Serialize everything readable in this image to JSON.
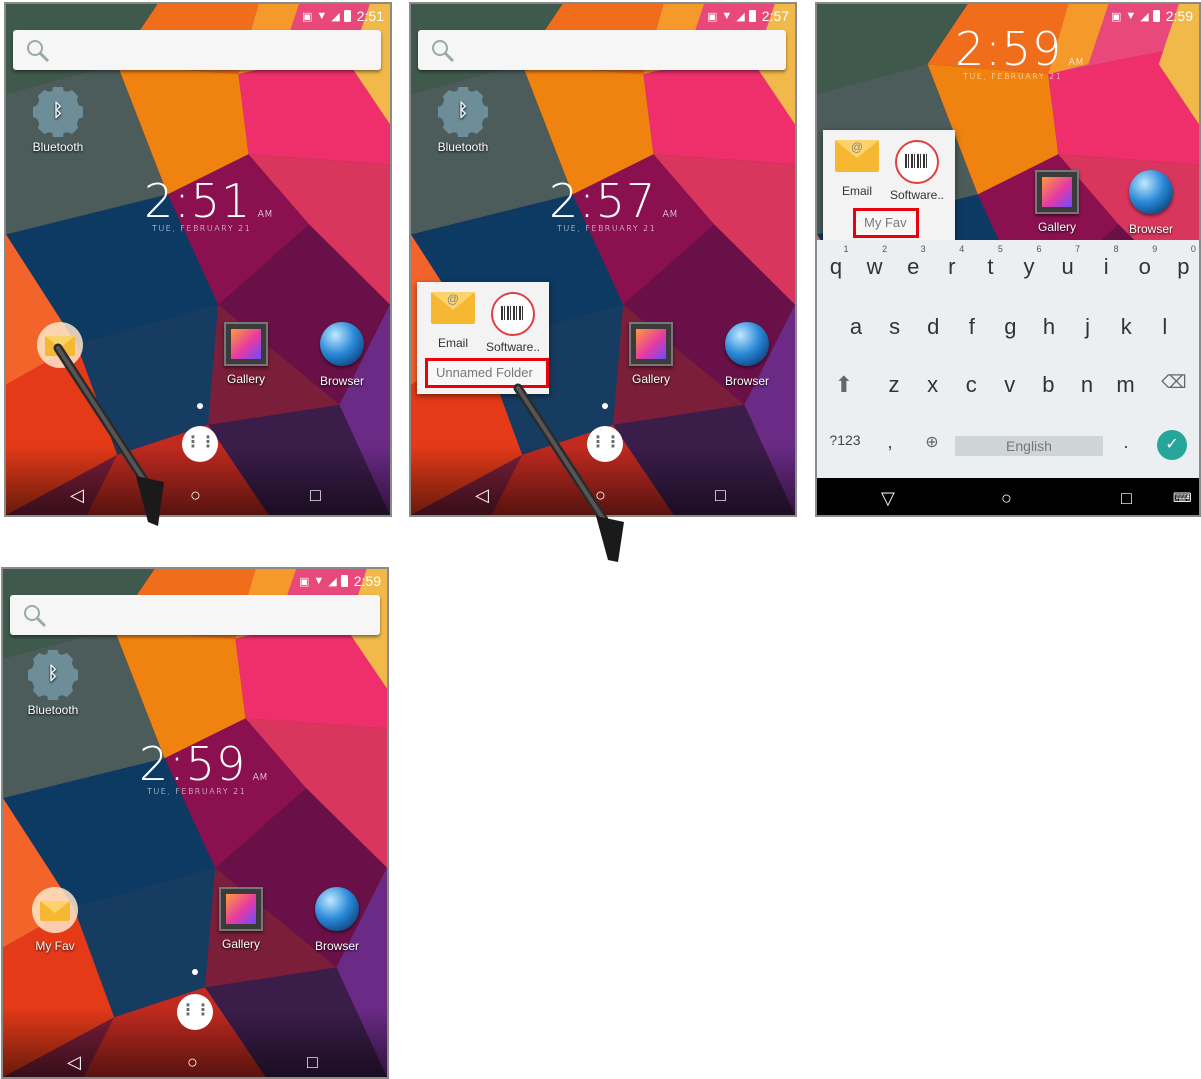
{
  "panel1": {
    "time": "2:51",
    "clock_big": "2:51",
    "clock_ampm": "AM",
    "date": "TUE, FEBRUARY 21",
    "apps": {
      "bluetooth": "Bluetooth",
      "gallery": "Gallery",
      "browser": "Browser"
    }
  },
  "panel2": {
    "time": "2:57",
    "clock_big": "2:57",
    "clock_ampm": "AM",
    "date": "TUE, FEBRUARY 21",
    "apps": {
      "bluetooth": "Bluetooth",
      "gallery": "Gallery",
      "browser": "Browser"
    },
    "folder": {
      "items": [
        "Email",
        "Software.."
      ],
      "name": "Unnamed Folder"
    }
  },
  "panel3": {
    "time": "2:59",
    "clock_big": "2:59",
    "clock_ampm": "AM",
    "date": "TUE, FEBRUARY 21",
    "apps": {
      "gallery": "Gallery",
      "browser": "Browser"
    },
    "folder": {
      "items": [
        "Email",
        "Software.."
      ],
      "name": "My Fav"
    },
    "keyboard": {
      "row1": [
        "q",
        "w",
        "e",
        "r",
        "t",
        "y",
        "u",
        "i",
        "o",
        "p"
      ],
      "row1_hints": [
        "1",
        "2",
        "3",
        "4",
        "5",
        "6",
        "7",
        "8",
        "9",
        "0"
      ],
      "row2": [
        "a",
        "s",
        "d",
        "f",
        "g",
        "h",
        "j",
        "k",
        "l"
      ],
      "row3": [
        "z",
        "x",
        "c",
        "v",
        "b",
        "n",
        "m"
      ],
      "symbols_key": "?123",
      "comma_key": ",",
      "period_key": ".",
      "space_label": "English"
    }
  },
  "panel4": {
    "time": "2:59",
    "clock_big": "2:59",
    "clock_ampm": "AM",
    "date": "TUE, FEBRUARY 21",
    "apps": {
      "bluetooth": "Bluetooth",
      "myfav": "My Fav",
      "gallery": "Gallery",
      "browser": "Browser"
    }
  },
  "icons": [
    "search-icon",
    "bluetooth-icon",
    "gallery-icon",
    "browser-icon",
    "email-icon",
    "barcode-icon",
    "app-drawer-icon",
    "back-icon",
    "home-icon",
    "recents-icon",
    "shift-icon",
    "backspace-icon",
    "globe-icon",
    "enter-check-icon",
    "keyboard-icon",
    "wifi-icon",
    "battery-icon"
  ],
  "colors": {
    "highlight": "#e8000b",
    "accent_check": "#26a69a"
  }
}
